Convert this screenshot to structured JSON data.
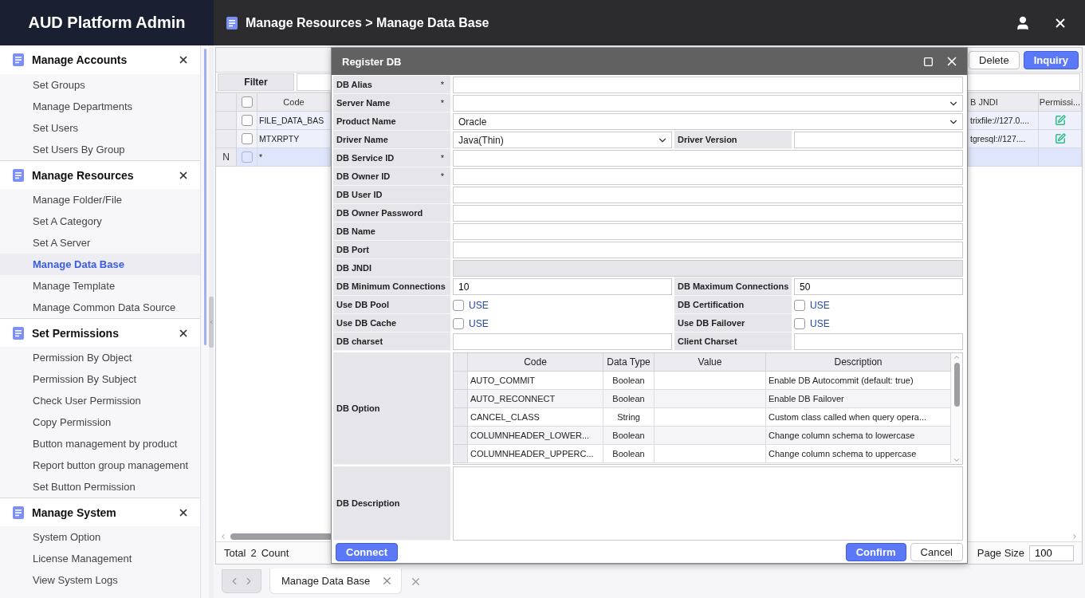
{
  "app_title": "AUD Platform Admin",
  "breadcrumb": "Manage Resources > Manage Data Base",
  "sidebar": {
    "sections": [
      {
        "title": "Manage Accounts",
        "items": [
          {
            "label": "Set Groups",
            "selected": false
          },
          {
            "label": "Manage Departments",
            "selected": false
          },
          {
            "label": "Set Users",
            "selected": false
          },
          {
            "label": "Set Users By Group",
            "selected": false
          }
        ]
      },
      {
        "title": "Manage Resources",
        "items": [
          {
            "label": "Manage Folder/File",
            "selected": false
          },
          {
            "label": "Set A Category",
            "selected": false
          },
          {
            "label": "Set A Server",
            "selected": false
          },
          {
            "label": "Manage Data Base",
            "selected": true
          },
          {
            "label": "Manage Template",
            "selected": false
          },
          {
            "label": "Manage Common Data Source",
            "selected": false
          }
        ]
      },
      {
        "title": "Set Permissions",
        "items": [
          {
            "label": "Permission By Object",
            "selected": false
          },
          {
            "label": "Permission By Subject",
            "selected": false
          },
          {
            "label": "Check User Permission",
            "selected": false
          },
          {
            "label": "Copy Permission",
            "selected": false
          },
          {
            "label": "Button management by product",
            "selected": false
          },
          {
            "label": "Report button group management",
            "selected": false
          },
          {
            "label": "Set Button Permission",
            "selected": false
          }
        ]
      },
      {
        "title": "Manage System",
        "items": [
          {
            "label": "System Option",
            "selected": false
          },
          {
            "label": "License Management",
            "selected": false
          },
          {
            "label": "View System Logs",
            "selected": false
          }
        ]
      }
    ]
  },
  "toolbar": {
    "buttons": [
      {
        "label": "Delete",
        "kind": "default"
      },
      {
        "label": "Inquiry",
        "kind": "primary"
      }
    ]
  },
  "filter": {
    "label": "Filter"
  },
  "grid": {
    "columns": {
      "code": "Code",
      "jndi": "B JNDI",
      "permission": "Permissi..."
    },
    "header_checked": false,
    "rows": [
      {
        "kind": "data",
        "checked": false,
        "code": "FILE_DATA_BAS",
        "jndi": "trixfile://127.0...."
      },
      {
        "kind": "data",
        "checked": false,
        "code": "MTXRPTY",
        "jndi": "tgresql://127...."
      },
      {
        "kind": "new",
        "row_header": "N",
        "checked": false,
        "code": "*"
      }
    ]
  },
  "footer": {
    "total_label": "Total",
    "count": "2",
    "count_label": "Count",
    "page_size_label": "Page Size",
    "page_size": "100"
  },
  "tabs": [
    {
      "label": "Manage Data Base",
      "selected": true
    }
  ],
  "dialog": {
    "title": "Register DB",
    "rows": [
      [
        {
          "label": "DB Alias",
          "required": true,
          "kind": "text"
        }
      ],
      [
        {
          "label": "Server Name",
          "required": true,
          "kind": "select"
        }
      ],
      [
        {
          "label": "Product Name",
          "required": false,
          "kind": "select",
          "value": "Oracle"
        }
      ],
      [
        {
          "label": "Driver Name",
          "required": false,
          "kind": "select",
          "value": "Java(Thin)"
        },
        {
          "label": "Driver Version",
          "required": false,
          "kind": "text"
        }
      ],
      [
        {
          "label": "DB Service ID",
          "required": true,
          "kind": "text"
        }
      ],
      [
        {
          "label": "DB Owner ID",
          "required": true,
          "kind": "text"
        }
      ],
      [
        {
          "label": "DB User ID",
          "required": false,
          "kind": "text"
        }
      ],
      [
        {
          "label": "DB Owner Password",
          "required": false,
          "kind": "text"
        }
      ],
      [
        {
          "label": "DB Name",
          "required": false,
          "kind": "text"
        }
      ],
      [
        {
          "label": "DB Port",
          "required": false,
          "kind": "text"
        }
      ],
      [
        {
          "label": "DB JNDI",
          "required": false,
          "kind": "disabled"
        }
      ],
      [
        {
          "label": "DB Minimum Connections",
          "required": false,
          "kind": "text",
          "value": "10"
        },
        {
          "label": "DB Maximum Connections",
          "required": false,
          "kind": "text",
          "value": "50"
        }
      ],
      [
        {
          "label": "Use DB Pool",
          "required": false,
          "kind": "checkbox",
          "checked": false,
          "option_label": "USE"
        },
        {
          "label": "DB Certification",
          "required": false,
          "kind": "checkbox",
          "checked": false,
          "option_label": "USE"
        }
      ],
      [
        {
          "label": "Use DB Cache",
          "required": false,
          "kind": "checkbox",
          "checked": false,
          "option_label": "USE"
        },
        {
          "label": "Use DB Failover",
          "required": false,
          "kind": "checkbox",
          "checked": false,
          "option_label": "USE"
        }
      ],
      [
        {
          "label": "DB charset",
          "required": false,
          "kind": "text"
        },
        {
          "label": "Client Charset",
          "required": false,
          "kind": "text"
        }
      ]
    ],
    "option": {
      "label": "DB Option",
      "columns": [
        "Code",
        "Data Type",
        "Value",
        "Description"
      ],
      "rows": [
        {
          "code": "AUTO_COMMIT",
          "data_type": "Boolean",
          "description": "Enable DB Autocommit (default: true)"
        },
        {
          "code": "AUTO_RECONNECT",
          "data_type": "Boolean",
          "description": "Enable DB Failover"
        },
        {
          "code": "CANCEL_CLASS",
          "data_type": "String",
          "description": "Custom class called when query opera..."
        },
        {
          "code": "COLUMNHEADER_LOWER...",
          "data_type": "Boolean",
          "description": "Change column schema to lowercase"
        },
        {
          "code": "COLUMNHEADER_UPPERC...",
          "data_type": "Boolean",
          "description": "Change column schema to uppercase"
        }
      ]
    },
    "description_label": "DB Description",
    "buttons_left": [
      {
        "label": "Connect",
        "kind": "primary"
      }
    ],
    "buttons_right": [
      {
        "label": "Confirm",
        "kind": "primary"
      },
      {
        "label": "Cancel",
        "kind": "default"
      }
    ]
  }
}
